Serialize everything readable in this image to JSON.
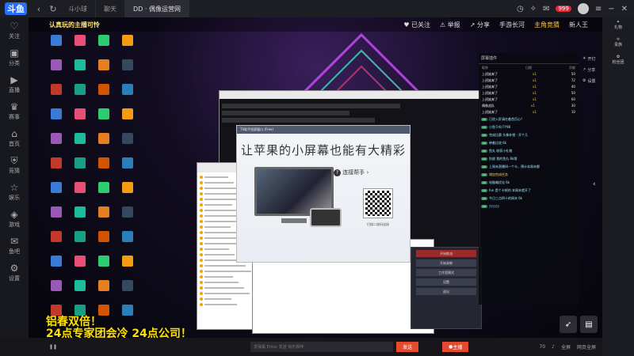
{
  "browser": {
    "logo": "斗鱼",
    "tabs": [
      {
        "label": "斗小球",
        "active": false
      },
      {
        "label": "聊天",
        "active": false
      },
      {
        "label": "DD · 偶像运营网",
        "active": true
      }
    ],
    "badge": "999",
    "colors": {
      "accent": "#2a6df6",
      "live_red": "#e64a2e",
      "gold": "#ffe200"
    }
  },
  "sidebar": {
    "items": [
      {
        "icon": "heart-icon",
        "glyph": "♡",
        "label": "关注"
      },
      {
        "icon": "tv-icon",
        "glyph": "▣",
        "label": "分类"
      },
      {
        "icon": "play-icon",
        "glyph": "▶",
        "label": "直播"
      },
      {
        "icon": "trophy-icon",
        "glyph": "♛",
        "label": "赛事"
      },
      {
        "icon": "home-icon",
        "glyph": "⌂",
        "label": "首页"
      },
      {
        "icon": "shield-icon",
        "glyph": "⛨",
        "label": "竞猜"
      },
      {
        "icon": "star-icon",
        "glyph": "☆",
        "label": "娱乐"
      },
      {
        "icon": "game-icon",
        "glyph": "◈",
        "label": "游戏"
      },
      {
        "icon": "chat-icon",
        "glyph": "✉",
        "label": "鱼吧"
      },
      {
        "icon": "gear-icon",
        "glyph": "⚙",
        "label": "设置"
      }
    ]
  },
  "stream": {
    "overlay_title": "认真玩的主播可怜",
    "follow_label": "已关注",
    "report_label": "举报",
    "share_label": "分享",
    "nav_right": [
      "手游长河",
      "主角竞猜",
      "新人王"
    ],
    "big_text_line1": "铝春双倍！",
    "big_text_line2": "24点专家团会冷 24点公司！"
  },
  "ad": {
    "bar_text": "TV助手投屏窗口 (Free)",
    "title": "让苹果的小屏幕也能有大精彩",
    "link_label": "连接帮手",
    "qr_caption": "扫描二维码连接"
  },
  "obs": {
    "buttons": [
      "开始推流",
      "开始录制",
      "工作室模式",
      "设置",
      "退出"
    ]
  },
  "chat": {
    "title": "屏幕插件",
    "columns": [
      "昵称",
      "日期",
      "贡献"
    ],
    "rank_rows": [
      {
        "name": "上班族来了",
        "gift": "x1",
        "v": "50"
      },
      {
        "name": "上班族来了",
        "gift": "x1",
        "v": "72"
      },
      {
        "name": "上班族来了",
        "gift": "x1",
        "v": "40"
      },
      {
        "name": "上班族来了",
        "gift": "x1",
        "v": "50"
      },
      {
        "name": "上班族来了",
        "gift": "x1",
        "v": "60"
      },
      {
        "name": "偶像战队",
        "gift": "x1",
        "v": "30"
      },
      {
        "name": "上班族来了",
        "gift": "x1",
        "v": "10"
      }
    ],
    "messages": [
      {
        "tag": "LV",
        "text": "已经入肝请在着首页心？",
        "yellow": false
      },
      {
        "tag": "LV",
        "text": "小鱼干吗 FY98",
        "yellow": false
      },
      {
        "tag": "LV",
        "text": "完成比赛 头像补偿 · 开个几",
        "yellow": false
      },
      {
        "tag": "LV",
        "text": "带着比较 6k",
        "yellow": false
      },
      {
        "tag": "LV",
        "text": "鱼丸 收获小礼物",
        "yellow": false
      },
      {
        "tag": "LV",
        "text": "别放 我的鱼丸 6k哦",
        "yellow": false
      },
      {
        "tag": "LV",
        "text": "上周末直播间一个卡，预计本周末都",
        "yellow": false
      },
      {
        "tag": "LV",
        "text": "增加完成任务",
        "yellow": true
      },
      {
        "tag": "LV",
        "text": "电脑端优化 6k",
        "yellow": false
      },
      {
        "tag": "LV",
        "text": "fun 是个卡顿的 本周末就开了",
        "yellow": false
      },
      {
        "tag": "LV",
        "text": "今日三点四十的周末 6k",
        "yellow": false
      },
      {
        "tag": "LV",
        "text": "??????",
        "yellow": false
      }
    ]
  },
  "rightside": [
    "开灯",
    "分享",
    "设置"
  ],
  "bottombar": {
    "input_placeholder": "发弹幕 Enter 发送 快乐相伴",
    "send_label": "发送",
    "live_label": "主播",
    "count": "70",
    "right_labels": [
      "全屏",
      "网页全屏"
    ]
  },
  "rail": [
    "礼物",
    "贵族",
    "粉丝团"
  ]
}
